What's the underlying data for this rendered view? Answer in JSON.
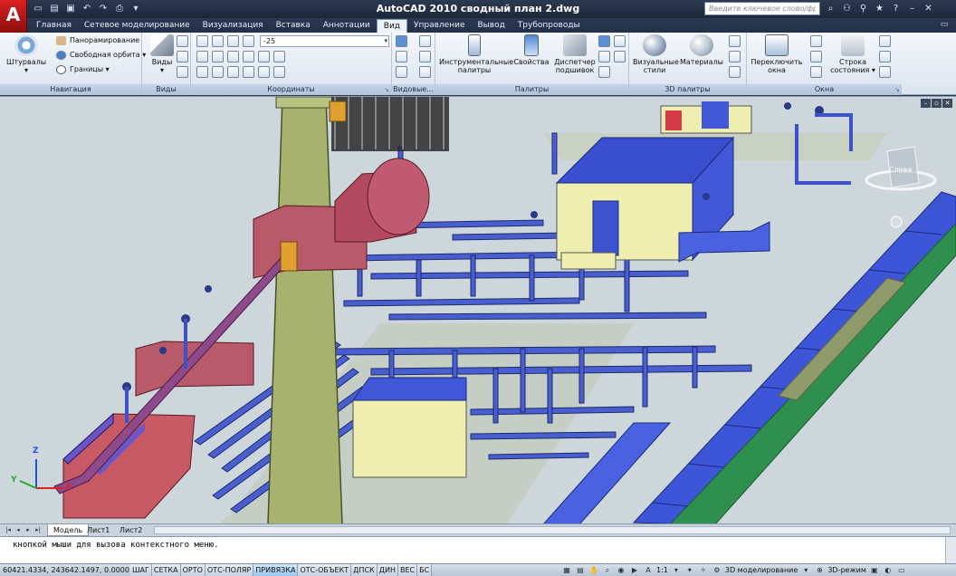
{
  "app": {
    "logo": "A",
    "title": "AutoCAD 2010    сводный план 2.dwg",
    "search_placeholder": "Введите ключевое слово/фразу"
  },
  "ribbon_tabs": [
    {
      "label": "Главная"
    },
    {
      "label": "Сетевое моделирование"
    },
    {
      "label": "Визуализация"
    },
    {
      "label": "Вставка"
    },
    {
      "label": "Аннотации"
    },
    {
      "label": "Вид"
    },
    {
      "label": "Управление"
    },
    {
      "label": "Вывод"
    },
    {
      "label": "Трубопроводы"
    }
  ],
  "active_tab": "Вид",
  "panels": {
    "navigation": {
      "title": "Навигация",
      "steering": "Штурвалы",
      "pan": "Панорамирование",
      "orbit": "Свободная орбита",
      "extents": "Границы"
    },
    "views": {
      "title": "Виды",
      "button": "Виды"
    },
    "coordinates": {
      "title": "Координаты",
      "combo_value": "-25"
    },
    "viewports": {
      "title": "Видовые..."
    },
    "palettes": {
      "title": "Палитры",
      "tool_palettes": "Инструментальные палитры",
      "properties": "Свойства",
      "sheet_set": "Диспетчер подшивок"
    },
    "palettes_3d": {
      "title": "3D палитры",
      "visual_styles": "Визуальные стили",
      "materials": "Материалы"
    },
    "windows": {
      "title": "Окна",
      "switch": "Переключить окна",
      "status_bar": "Строка состояния"
    }
  },
  "viewcube": {
    "label": "Слева"
  },
  "ucs": {
    "x": "X",
    "y": "Y",
    "z": "Z"
  },
  "layout_tabs": [
    {
      "label": "Модель",
      "active": true
    },
    {
      "label": "Лист1",
      "active": false
    },
    {
      "label": "Лист2",
      "active": false
    }
  ],
  "command_line": {
    "text": "кнопкой мыши для вызова контекстного меню."
  },
  "status_bar": {
    "coordinates": "60421.4334, 243642.1497, 0.0000",
    "toggles": [
      {
        "label": "ШАГ",
        "on": false
      },
      {
        "label": "СЕТКА",
        "on": false
      },
      {
        "label": "ОРТО",
        "on": false
      },
      {
        "label": "ОТС-ПОЛЯР",
        "on": false
      },
      {
        "label": "ПРИВЯЗКА",
        "on": true
      },
      {
        "label": "ОТС-ОБЪЕКТ",
        "on": false
      },
      {
        "label": "ДПСК",
        "on": false
      },
      {
        "label": "ДИН",
        "on": false
      },
      {
        "label": "ВЕС",
        "on": false
      },
      {
        "label": "БС",
        "on": false
      }
    ],
    "scale": "1:1",
    "workspace": "3D моделирование",
    "mode": "3D-режим"
  },
  "colors": {
    "title_bg": "#1f2b40",
    "ribbon_bg": "#e3eaf3",
    "viewport_bg": "#cdd6db",
    "pipe_blue": "#3f55c9",
    "tray_green": "#3f9f5a",
    "building_yellow": "#f0f0b0",
    "tank_red": "#b85a6a",
    "tower_green": "#9aa86a"
  },
  "icons": {
    "qat": [
      "new-icon",
      "open-icon",
      "save-icon",
      "undo-icon",
      "redo-icon",
      "plot-icon"
    ],
    "title_tools": [
      "search-icon",
      "binoculars-icon",
      "user-icon",
      "star-icon",
      "help-icon"
    ]
  }
}
